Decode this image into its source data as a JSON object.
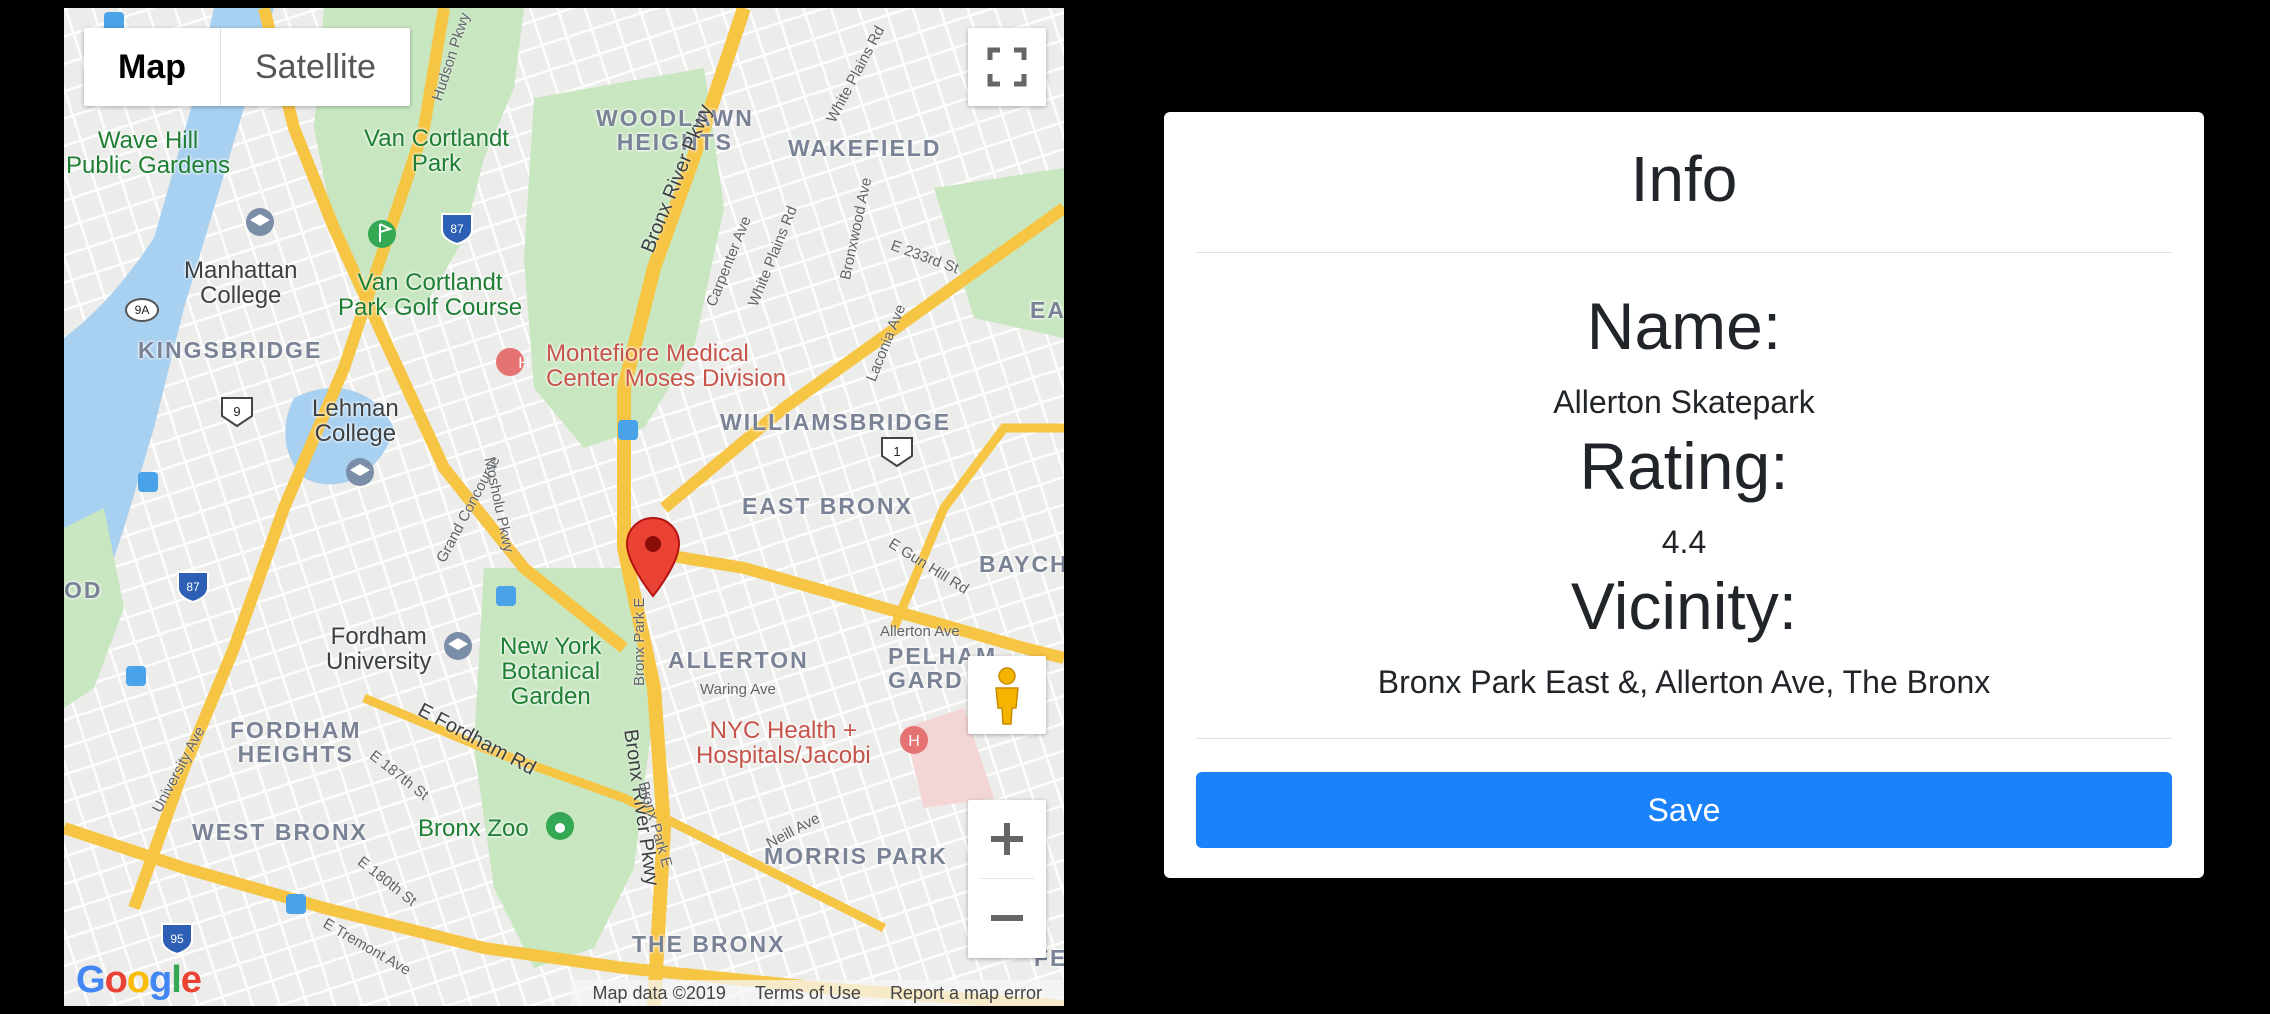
{
  "map": {
    "map_type_buttons": [
      "Map",
      "Satellite"
    ],
    "labels": {
      "wave_hill": "Wave Hill\nPublic Gardens",
      "van_cortlandt_park": "Van Cortlandt\nPark",
      "manhattan_college": "Manhattan\nCollege",
      "van_cortlandt_golf": "Van Cortlandt\nPark Golf Course",
      "kingsbridge": "KINGSBRIDGE",
      "montefiore": "Montefiore Medical\nCenter Moses Division",
      "lehman": "Lehman\nCollege",
      "woodlawn": "WOODLAWN\nHEIGHTS",
      "wakefield": "WAKEFIELD",
      "williamsbridge": "WILLIAMSBRIDGE",
      "east_bronx": "EAST BRONX",
      "baych": "BAYCH",
      "ea": "EA",
      "od": "OD",
      "allerton": "ALLERTON",
      "pelham": "PELHAM\nGARD",
      "fordham_univ": "Fordham\nUniversity",
      "ny_botanical": "New York\nBotanical\nGarden",
      "nyc_health": "NYC Health +\nHospitals/Jacobi",
      "fordham_heights": "FORDHAM\nHEIGHTS",
      "west_bronx": "WEST BRONX",
      "bronx_zoo": "Bronx Zoo",
      "morris_park": "MORRIS PARK",
      "the_bronx": "THE BRONX",
      "fe": "FE",
      "bronx_river_pkwy_n": "Bronx River Pkwy",
      "bronx_river_pkwy_s": "Bronx River Pkwy",
      "e_fordham_rd": "E Fordham Rd",
      "carpenter_ave": "Carpenter Ave",
      "white_plains_rd": "White Plains Rd",
      "white_plains_rd_top": "White Plains Rd",
      "bronxwood_ave": "Bronxwood Ave",
      "e_233rd_st": "E 233rd St",
      "laconia_ave": "Laconia Ave",
      "grand_concourse": "Grand Concourse",
      "mosholu_pkwy": "Mosholu Pkwy",
      "bronx_park_e": "Bronx Park E",
      "bronx_park_e2": "Bronx Park E",
      "e_gun_hill_rd": "E Gun Hill Rd",
      "allerton_ave": "Allerton Ave",
      "waring_ave": "Waring Ave",
      "neill_ave": "Neill Ave",
      "university_ave": "University Ave",
      "e_187th_st": "E 187th St",
      "e_180th_st": "E 180th St",
      "e_tremont_ave": "E Tremont Ave",
      "hudson_pkwy": "Hudson Pkwy"
    },
    "shields": [
      "87",
      "9A",
      "9",
      "1",
      "87",
      "95"
    ],
    "google_letters": [
      "G",
      "o",
      "o",
      "g",
      "l",
      "e"
    ],
    "attribution": [
      "Map data ©2019",
      "Terms of Use",
      "Report a map error"
    ]
  },
  "info": {
    "title": "Info",
    "name_label": "Name:",
    "name_value": "Allerton Skatepark",
    "rating_label": "Rating:",
    "rating_value": "4.4",
    "vicinity_label": "Vicinity:",
    "vicinity_value": "Bronx Park East &, Allerton Ave, The Bronx",
    "save_label": "Save"
  },
  "colors": {
    "save_button": "#1a82fb",
    "map_background": "#ececea",
    "park_green": "#c8e6c0",
    "water": "#a8d0f0",
    "highway": "#f7c544",
    "pin": "#ea4335"
  },
  "icons": [
    "fullscreen-icon",
    "pegman-icon",
    "zoom-in-icon",
    "zoom-out-icon",
    "map-pin-icon",
    "hospital-icon",
    "transit-icon",
    "university-icon",
    "zoo-icon",
    "golf-icon"
  ]
}
